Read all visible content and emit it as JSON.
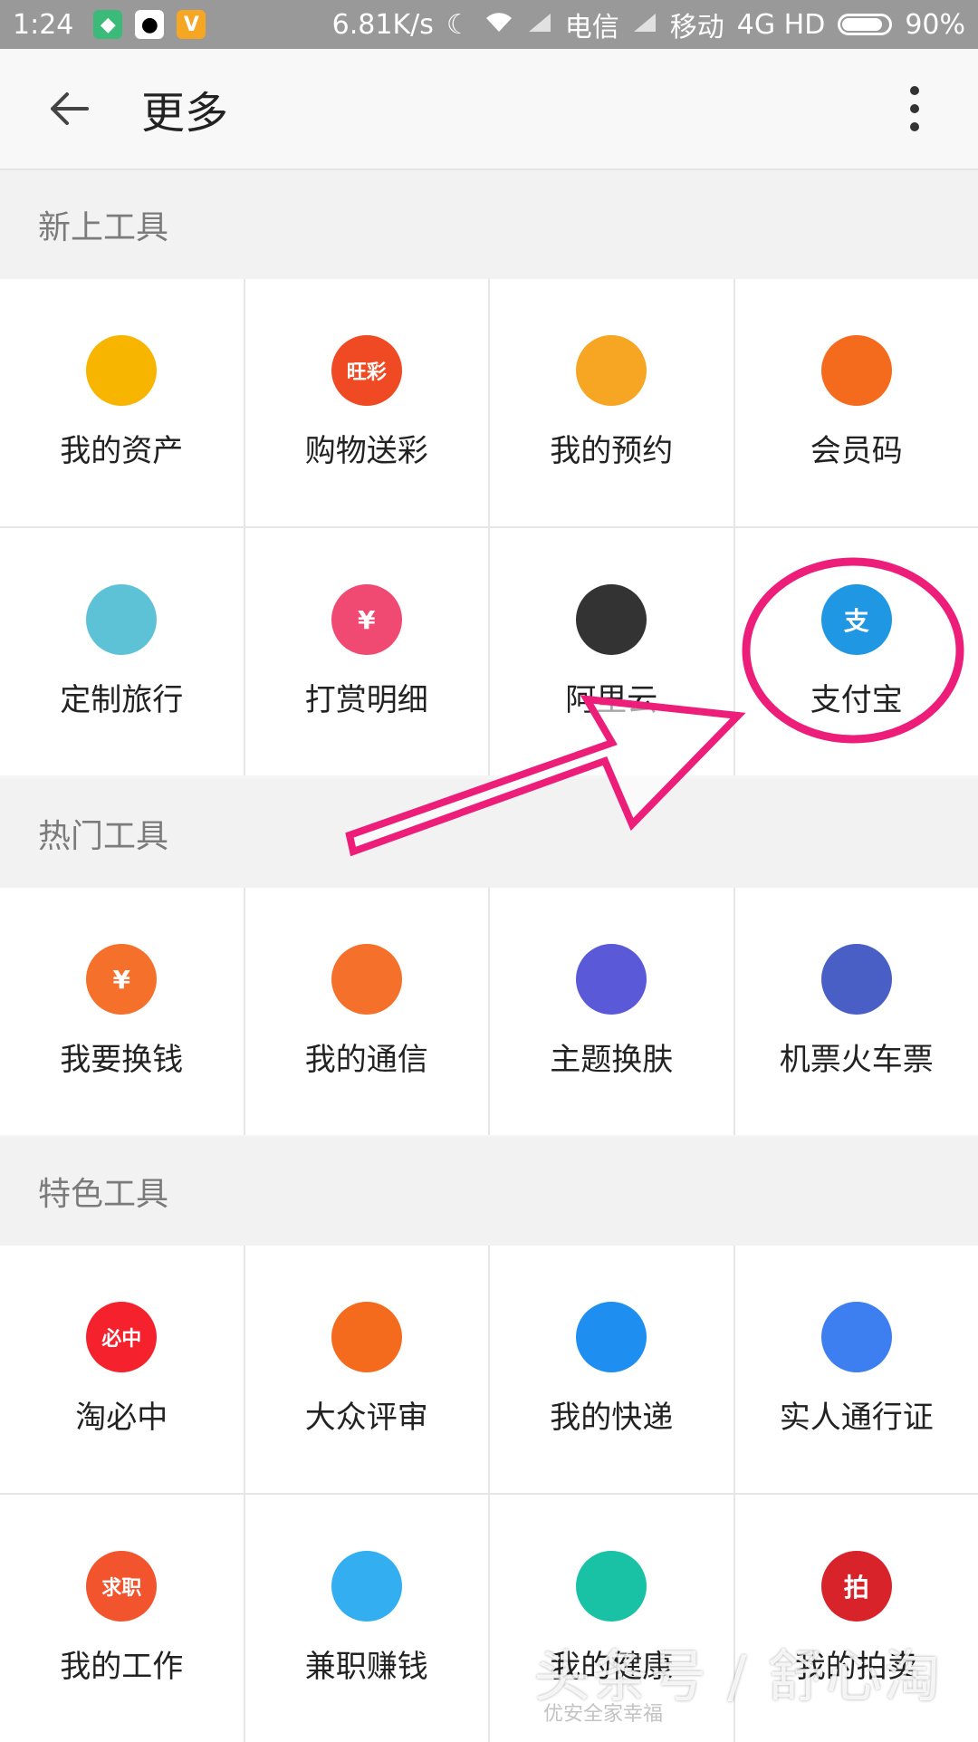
{
  "status": {
    "time": "1:24",
    "speed": "6.81K/s",
    "carrier1": "电信",
    "carrier2": "移动",
    "network": "4G HD",
    "battery": "90%"
  },
  "appbar": {
    "title": "更多"
  },
  "sections": [
    {
      "title": "新上工具",
      "items": [
        {
          "label": "我的资产",
          "icon": "money-bag-icon",
          "color": "#f7b500"
        },
        {
          "label": "购物送彩",
          "icon": "lottery-icon",
          "color": "#ef4a23",
          "glyph": "旺彩"
        },
        {
          "label": "我的预约",
          "icon": "notepad-icon",
          "color": "#f6a623"
        },
        {
          "label": "会员码",
          "icon": "qrcode-icon",
          "color": "#f56b1e"
        },
        {
          "label": "定制旅行",
          "icon": "pencil-ruler-icon",
          "color": "#5ec2d6"
        },
        {
          "label": "打赏明细",
          "icon": "reward-hand-icon",
          "color": "#f04a73",
          "glyph": "¥"
        },
        {
          "label": "阿里云",
          "icon": "aliyun-icon",
          "color": "#333333"
        },
        {
          "label": "支付宝",
          "icon": "alipay-icon",
          "color": "#1f97e3",
          "glyph": "支"
        }
      ]
    },
    {
      "title": "热门工具",
      "items": [
        {
          "label": "我要换钱",
          "icon": "coin-bag-icon",
          "color": "#f5702a",
          "glyph": "¥"
        },
        {
          "label": "我的通信",
          "icon": "phone-icon",
          "color": "#f5702a"
        },
        {
          "label": "主题换肤",
          "icon": "palette-icon",
          "color": "#5a5ad8"
        },
        {
          "label": "机票火车票",
          "icon": "plane-icon",
          "color": "#4a5fc6"
        }
      ]
    },
    {
      "title": "特色工具",
      "items": [
        {
          "label": "淘必中",
          "icon": "taobizhong-icon",
          "color": "#f5222d",
          "glyph": "必中"
        },
        {
          "label": "大众评审",
          "icon": "judge-icon",
          "color": "#f56b1e"
        },
        {
          "label": "我的快递",
          "icon": "bird-icon",
          "color": "#1e8ff0"
        },
        {
          "label": "实人通行证",
          "icon": "verified-person-icon",
          "color": "#3d7ff0"
        },
        {
          "label": "我的工作",
          "icon": "job-icon",
          "color": "#f2542d",
          "glyph": "求职"
        },
        {
          "label": "兼职赚钱",
          "icon": "cloud-person-icon",
          "color": "#33aef0"
        },
        {
          "label": "我的健康",
          "icon": "heart-pulse-icon",
          "color": "#19c2a4"
        },
        {
          "label": "我的拍卖",
          "icon": "auction-icon",
          "color": "#d8232a",
          "glyph": "拍"
        }
      ]
    }
  ],
  "watermark": {
    "text": "头条号 / 舒心淘",
    "sub": "优安全家幸福"
  }
}
